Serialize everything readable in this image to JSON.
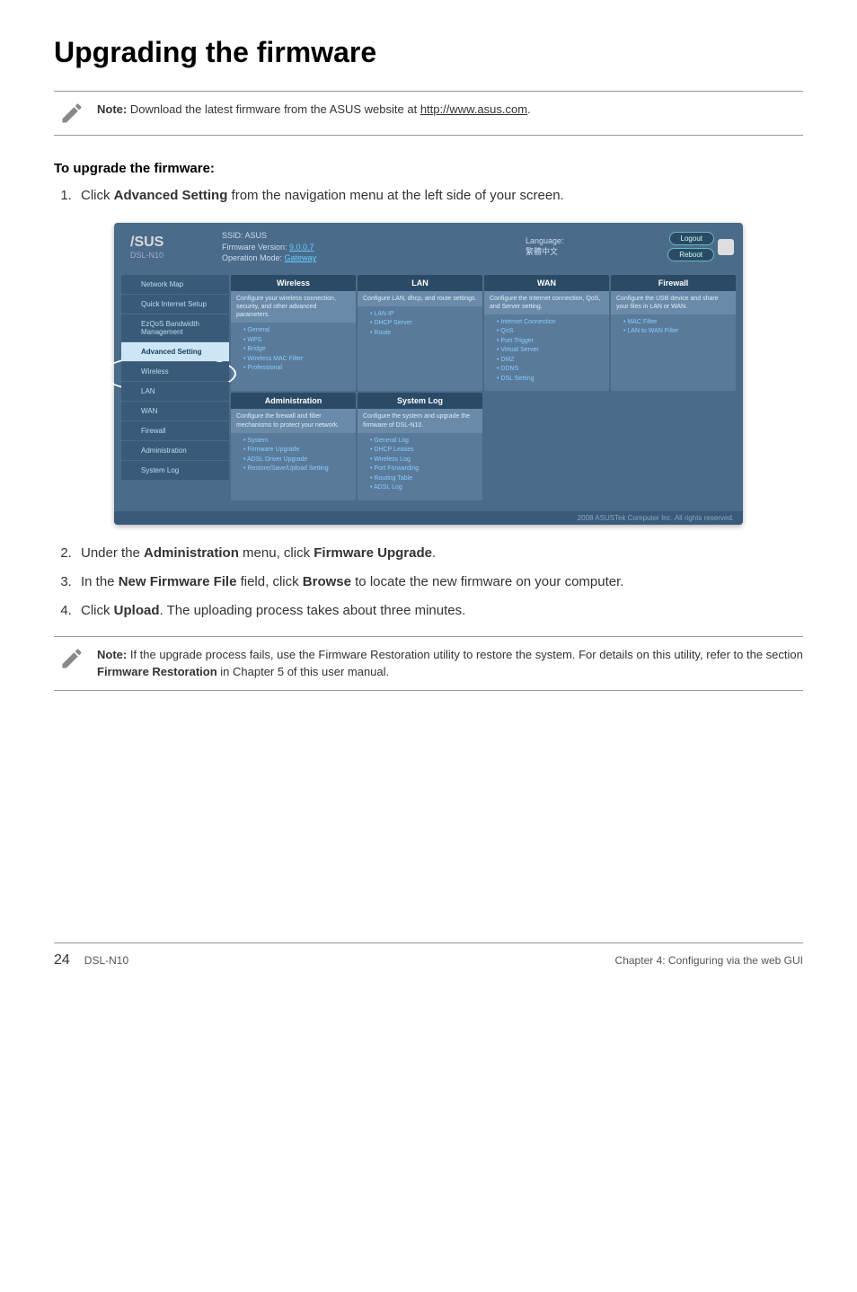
{
  "title": "Upgrading the firmware",
  "note1": {
    "label": "Note:",
    "text": " Download the latest firmware from the ASUS website at ",
    "link": "http://www.asus.com",
    "tail": "."
  },
  "subheading": "To upgrade the firmware:",
  "steps_part1": [
    {
      "pre": "Click ",
      "bold": "Advanced Setting",
      "post": " from the navigation menu at the left side of your screen."
    }
  ],
  "screenshot": {
    "logo": "/SUS",
    "model": "DSL-N10",
    "info": {
      "ssid_label": "SSID: ASUS",
      "fw_label": "Firmware Version: ",
      "fw_link": "9.0.0.7",
      "mode_label": "Operation Mode: ",
      "mode_link": "Gateway"
    },
    "language_label": "Language:",
    "language_value": "繁體中文",
    "btn_logout": "Logout",
    "btn_reboot": "Reboot",
    "sidebar": [
      "Network Map",
      "Quick Internet Setup",
      "EzQoS Bandwidth Management",
      "Advanced Setting",
      "Wireless",
      "LAN",
      "WAN",
      "Firewall",
      "Administration",
      "System Log"
    ],
    "panels": [
      {
        "head": "Wireless",
        "desc": "Configure your wireless connection, security, and other advanced parameters.",
        "items": [
          "General",
          "WPS",
          "Bridge",
          "Wireless MAC Filter",
          "Professional"
        ]
      },
      {
        "head": "LAN",
        "desc": "Configure LAN, dhcp, and route settings.",
        "items": [
          "LAN IP",
          "DHCP Server",
          "Route"
        ]
      },
      {
        "head": "WAN",
        "desc": "Configure the Internet connection, QoS, and Server setting.",
        "items": [
          "Internet Connection",
          "QoS",
          "Port Trigger",
          "Virtual Server",
          "DMZ",
          "DDNS",
          "DSL Setting"
        ]
      },
      {
        "head": "Firewall",
        "desc": "Configure the USB device and share your files in LAN or WAN.",
        "items": [
          "MAC Filter",
          "LAN to WAN Filter"
        ]
      },
      {
        "head": "Administration",
        "desc": "Configure the firewall and filter mechanisms to protect your network.",
        "items": [
          "System",
          "Firmware Upgrade",
          "ADSL Driver Upgrade",
          "Restore/Save/Upload Setting"
        ]
      },
      {
        "head": "System Log",
        "desc": "Configure the system and upgrade the firmware of DSL-N10.",
        "items": [
          "General Log",
          "DHCP Leases",
          "Wireless Log",
          "Port Forwarding",
          "Routing Table",
          "ADSL Log"
        ]
      }
    ],
    "footer": "2008 ASUSTek Computer Inc. All rights reserved."
  },
  "steps_part2": [
    {
      "pre": "Under the ",
      "bold": "Administration",
      "mid": " menu, click ",
      "bold2": "Firmware Upgrade",
      "post": "."
    },
    {
      "pre": "In the ",
      "bold": "New Firmware File",
      "mid": " field, click ",
      "bold2": "Browse",
      "post": " to locate the new firmware on your computer."
    },
    {
      "pre": "Click ",
      "bold": "Upload",
      "post": ". The uploading process takes about three minutes."
    }
  ],
  "note2": {
    "label": "Note:",
    "text": " If the upgrade process fails, use the Firmware Restoration utility to restore the system. For details on this utility, refer to the section ",
    "bold": "Firmware Restoration",
    "tail": " in Chapter 5 of this user manual."
  },
  "footer": {
    "page": "24",
    "model": "DSL-N10",
    "chapter": "Chapter 4: Configuring via the web GUI"
  }
}
